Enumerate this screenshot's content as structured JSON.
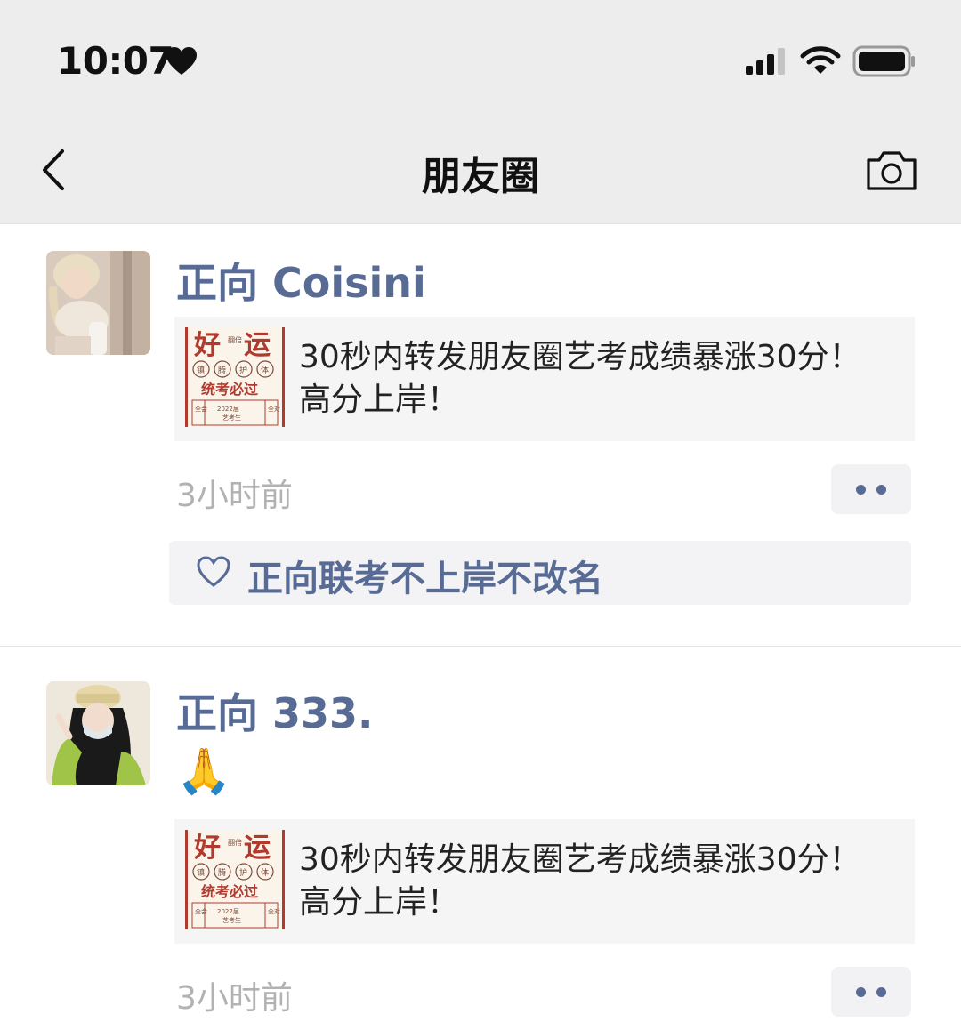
{
  "status_bar": {
    "time": "10:07"
  },
  "nav": {
    "title": "朋友圈"
  },
  "posts": [
    {
      "author": "正向 Coisini",
      "emoji": "",
      "link_card": {
        "text": "30秒内转发朋友圈艺考成绩暴涨30分！高分上岸！",
        "thumb": {
          "big1": "好",
          "big2": "运",
          "side": "翻倍",
          "row": [
            "镇",
            "腾",
            "护",
            "体"
          ],
          "main": "统考必过",
          "bottom_left": "全会",
          "bottom_mid": "2022届",
          "bottom_sub": "艺考生",
          "bottom_right": "全对"
        }
      },
      "time": "3小时前",
      "likes": "正向联考不上岸不改名"
    },
    {
      "author": "正向 333.",
      "emoji": "🙏",
      "link_card": {
        "text": "30秒内转发朋友圈艺考成绩暴涨30分！高分上岸！",
        "thumb": {
          "big1": "好",
          "big2": "运",
          "side": "翻倍",
          "row": [
            "镇",
            "腾",
            "护",
            "体"
          ],
          "main": "统考必过",
          "bottom_left": "全会",
          "bottom_mid": "2022届",
          "bottom_sub": "艺考生",
          "bottom_right": "全对"
        }
      },
      "time": "3小时前"
    }
  ],
  "colors": {
    "accent": "#576b95",
    "header_bg": "#ededed",
    "card_bg": "#f5f5f5",
    "thumb_red": "#b03a2e"
  }
}
